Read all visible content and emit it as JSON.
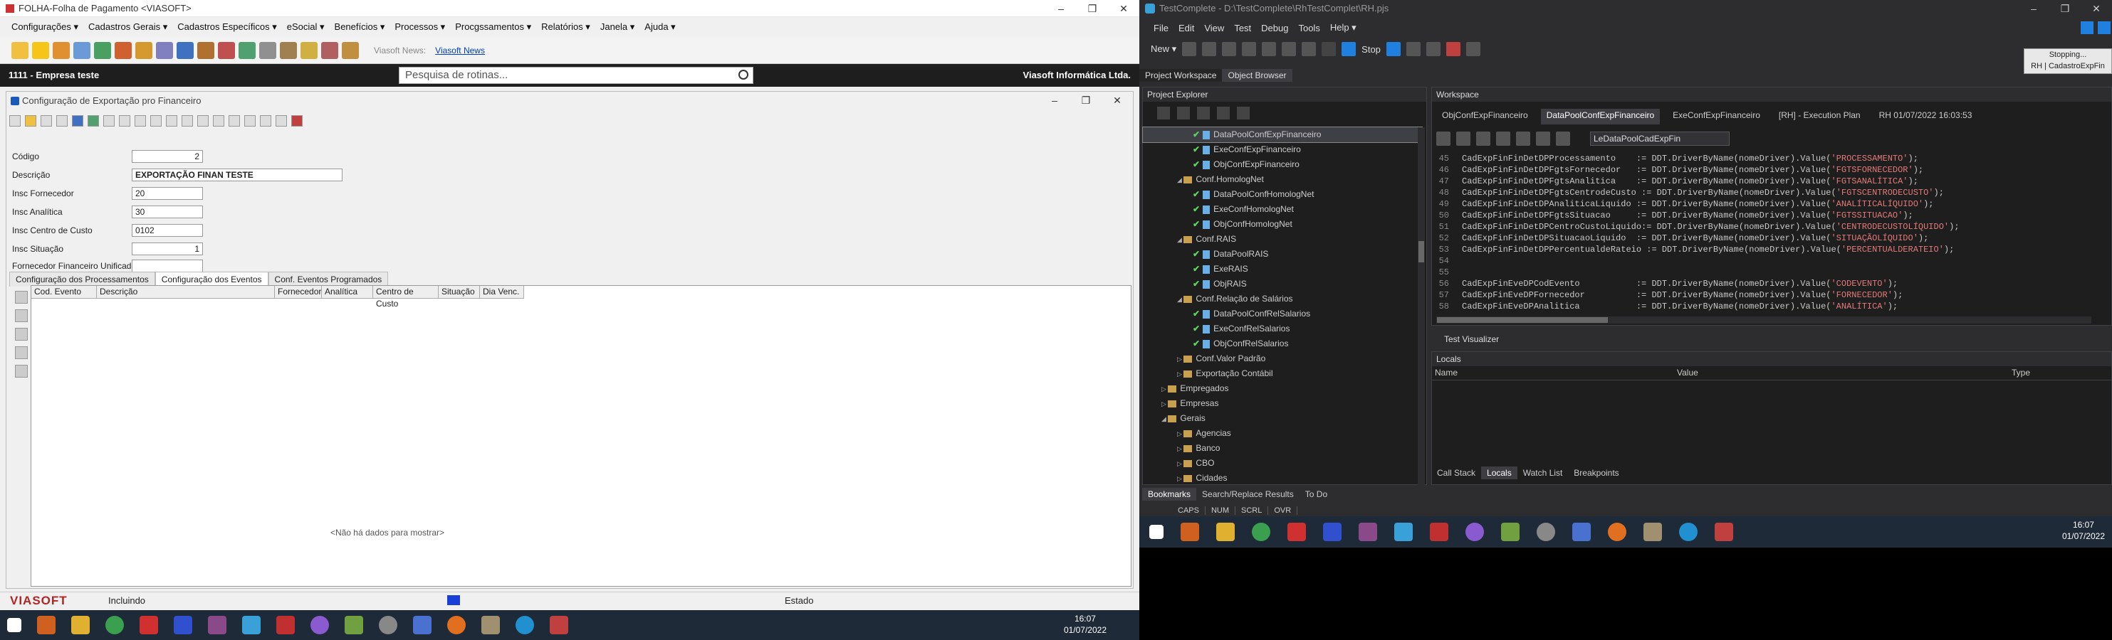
{
  "left": {
    "title": "FOLHA-Folha de Pagamento <VIASOFT>",
    "menu": [
      "Configurações ▾",
      "Cadastros Gerais ▾",
      "Cadastros Específicos ▾",
      "eSocial ▾",
      "Benefícios ▾",
      "Processos ▾",
      "Procgssamentos ▾",
      "Relatórios ▾",
      "Janela ▾",
      "Ajuda ▾"
    ],
    "news_label": "Viasoft News:",
    "news_link": "Viasoft News",
    "company": "1111 - Empresa teste",
    "vendor": "Viasoft Informática Ltda.",
    "search_placeholder": "Pesquisa de rotinas...",
    "form": {
      "title": "Configuração de Exportação pro Financeiro",
      "fields": [
        {
          "label": "Código",
          "value": "2"
        },
        {
          "label": "Descrição",
          "value": "EXPORTAÇÃO FINAN TESTE"
        },
        {
          "label": "Insc Fornecedor",
          "value": "20"
        },
        {
          "label": "Insc Analítica",
          "value": "30"
        },
        {
          "label": "Insc Centro de Custo",
          "value": "0102"
        },
        {
          "label": "Insc Situação",
          "value": "1"
        },
        {
          "label": "Fornecedor Financeiro Unificado",
          "value": ""
        }
      ],
      "tabs": [
        "Configuração dos Processamentos",
        "Configuração dos Eventos",
        "Conf. Eventos Programados"
      ],
      "grid_columns": [
        "Cod. Evento",
        "Descrição",
        "Fornecedor",
        "Analítica",
        "Centro de Custo",
        "Situação",
        "Dia Venc."
      ],
      "empty_text": "<Não há dados para mostrar>"
    },
    "status": {
      "logo": "VIASOFT",
      "mode": "Incluindo",
      "state": "Estado"
    },
    "clock": {
      "time": "16:07",
      "date": "01/07/2022"
    }
  },
  "right": {
    "title": "TestComplete - D:\\TestComplete\\RhTestComplet\\RH.pjs",
    "menu": [
      "File",
      "Edit",
      "View",
      "Test",
      "Debug",
      "Tools",
      "Help ▾"
    ],
    "new_label": "New ▾",
    "stop_label": "Stop",
    "stopping_tip": [
      "Stopping...",
      "RH | CadastroExpFin"
    ],
    "panel_tabs": [
      "Project Workspace",
      "Object Browser"
    ],
    "project_explorer": "Project Explorer",
    "tree": [
      {
        "label": "DataPoolConfExpFinanceiro",
        "type": "doc",
        "indent": 5,
        "chk": true,
        "sel": true
      },
      {
        "label": "ExeConfExpFinanceiro",
        "type": "doc",
        "indent": 5,
        "chk": true
      },
      {
        "label": "ObjConfExpFinanceiro",
        "type": "doc",
        "indent": 5,
        "chk": true
      },
      {
        "label": "Conf.HomologNet",
        "type": "fold",
        "indent": 4,
        "arrow": "◢"
      },
      {
        "label": "DataPoolConfHomologNet",
        "type": "doc",
        "indent": 5,
        "chk": true
      },
      {
        "label": "ExeConfHomologNet",
        "type": "doc",
        "indent": 5,
        "chk": true
      },
      {
        "label": "ObjConfHomologNet",
        "type": "doc",
        "indent": 5,
        "chk": true
      },
      {
        "label": "Conf.RAIS",
        "type": "fold",
        "indent": 4,
        "arrow": "◢"
      },
      {
        "label": "DataPoolRAIS",
        "type": "doc",
        "indent": 5,
        "chk": true
      },
      {
        "label": "ExeRAIS",
        "type": "doc",
        "indent": 5,
        "chk": true
      },
      {
        "label": "ObjRAIS",
        "type": "doc",
        "indent": 5,
        "chk": true
      },
      {
        "label": "Conf.Relação de Salários",
        "type": "fold",
        "indent": 4,
        "arrow": "◢"
      },
      {
        "label": "DataPoolConfRelSalarios",
        "type": "doc",
        "indent": 5,
        "chk": true
      },
      {
        "label": "ExeConfRelSalarios",
        "type": "doc",
        "indent": 5,
        "chk": true
      },
      {
        "label": "ObjConfRelSalarios",
        "type": "doc",
        "indent": 5,
        "chk": true
      },
      {
        "label": "Conf.Valor Padrão",
        "type": "fold",
        "indent": 4,
        "arrow": "▷"
      },
      {
        "label": "Exportação Contábil",
        "type": "fold",
        "indent": 4,
        "arrow": "▷"
      },
      {
        "label": "Empregados",
        "type": "fold",
        "indent": 3,
        "arrow": "▷"
      },
      {
        "label": "Empresas",
        "type": "fold",
        "indent": 3,
        "arrow": "▷"
      },
      {
        "label": "Gerais",
        "type": "fold",
        "indent": 3,
        "arrow": "◢"
      },
      {
        "label": "Agencias",
        "type": "fold",
        "indent": 4,
        "arrow": "▷"
      },
      {
        "label": "Banco",
        "type": "fold",
        "indent": 4,
        "arrow": "▷"
      },
      {
        "label": "CBO",
        "type": "fold",
        "indent": 4,
        "arrow": "▷"
      },
      {
        "label": "Cidades",
        "type": "fold",
        "indent": 4,
        "arrow": "▷"
      }
    ],
    "workspace": "Workspace",
    "ws_tabs": [
      "ObjConfExpFinanceiro",
      "DataPoolConfExpFinanceiro",
      "ExeConfExpFinanceiro",
      "[RH] - Execution Plan",
      "RH 01/07/2022 16:03:53"
    ],
    "ws_select": "LeDataPoolCadExpFin",
    "code": [
      {
        "n": "45",
        "a": "CadExpFinFinDetDPProcessamento    := DDT.DriverByName(nomeDriver).Value(",
        "s": "'PROCESSAMENTO'",
        "e": ");"
      },
      {
        "n": "46",
        "a": "CadExpFinFinDetDPFgtsFornecedor   := DDT.DriverByName(nomeDriver).Value(",
        "s": "'FGTSFORNECEDOR'",
        "e": ");"
      },
      {
        "n": "47",
        "a": "CadExpFinFinDetDPFgtsAnalitica    := DDT.DriverByName(nomeDriver).Value(",
        "s": "'FGTSANALÍTICA'",
        "e": ");"
      },
      {
        "n": "48",
        "a": "CadExpFinFinDetDPFgtsCentrodeCusto := DDT.DriverByName(nomeDriver).Value(",
        "s": "'FGTSCENTRODECUSTO'",
        "e": ");"
      },
      {
        "n": "49",
        "a": "CadExpFinFinDetDPAnaliticaLiquido := DDT.DriverByName(nomeDriver).Value(",
        "s": "'ANALÍTICALÍQUIDO'",
        "e": ");"
      },
      {
        "n": "50",
        "a": "CadExpFinFinDetDPFgtsSituacao     := DDT.DriverByName(nomeDriver).Value(",
        "s": "'FGTSSITUACAO'",
        "e": ");"
      },
      {
        "n": "51",
        "a": "CadExpFinFinDetDPCentroCustoLiquido:= DDT.DriverByName(nomeDriver).Value(",
        "s": "'CENTRODECUSTOLÍQUIDO'",
        "e": ");"
      },
      {
        "n": "52",
        "a": "CadExpFinFinDetDPSituacaoLiquido  := DDT.DriverByName(nomeDriver).Value(",
        "s": "'SITUAÇÃOLÍQUIDO'",
        "e": ");"
      },
      {
        "n": "53",
        "a": "CadExpFinFinDetDPPercentualdeRateio := DDT.DriverByName(nomeDriver).Value(",
        "s": "'PERCENTUALDERATEIO'",
        "e": ");"
      },
      {
        "n": "54",
        "a": "",
        "s": "",
        "e": ""
      },
      {
        "n": "55",
        "a": "",
        "s": "",
        "e": ""
      },
      {
        "n": "56",
        "a": "CadExpFinEveDPCodEvento           := DDT.DriverByName(nomeDriver).Value(",
        "s": "'CODEVENTO'",
        "e": ");"
      },
      {
        "n": "57",
        "a": "CadExpFinEveDPFornecedor          := DDT.DriverByName(nomeDriver).Value(",
        "s": "'FORNECEDOR'",
        "e": ");"
      },
      {
        "n": "58",
        "a": "CadExpFinEveDPAnalitica           := DDT.DriverByName(nomeDriver).Value(",
        "s": "'ANALÍTICA'",
        "e": ");"
      }
    ],
    "test_visualizer": "Test Visualizer",
    "locals": "Locals",
    "locals_cols": [
      "Name",
      "Value",
      "Type"
    ],
    "debug_tabs": [
      "Call Stack",
      "Locals",
      "Watch List",
      "Breakpoints"
    ],
    "bottom_tabs": [
      "Bookmarks",
      "Search/Replace Results",
      "To Do"
    ],
    "status_items": [
      "CAPS",
      "NUM",
      "SCRL",
      "OVR"
    ],
    "clock": {
      "time": "16:07",
      "date": "01/07/2022"
    }
  }
}
